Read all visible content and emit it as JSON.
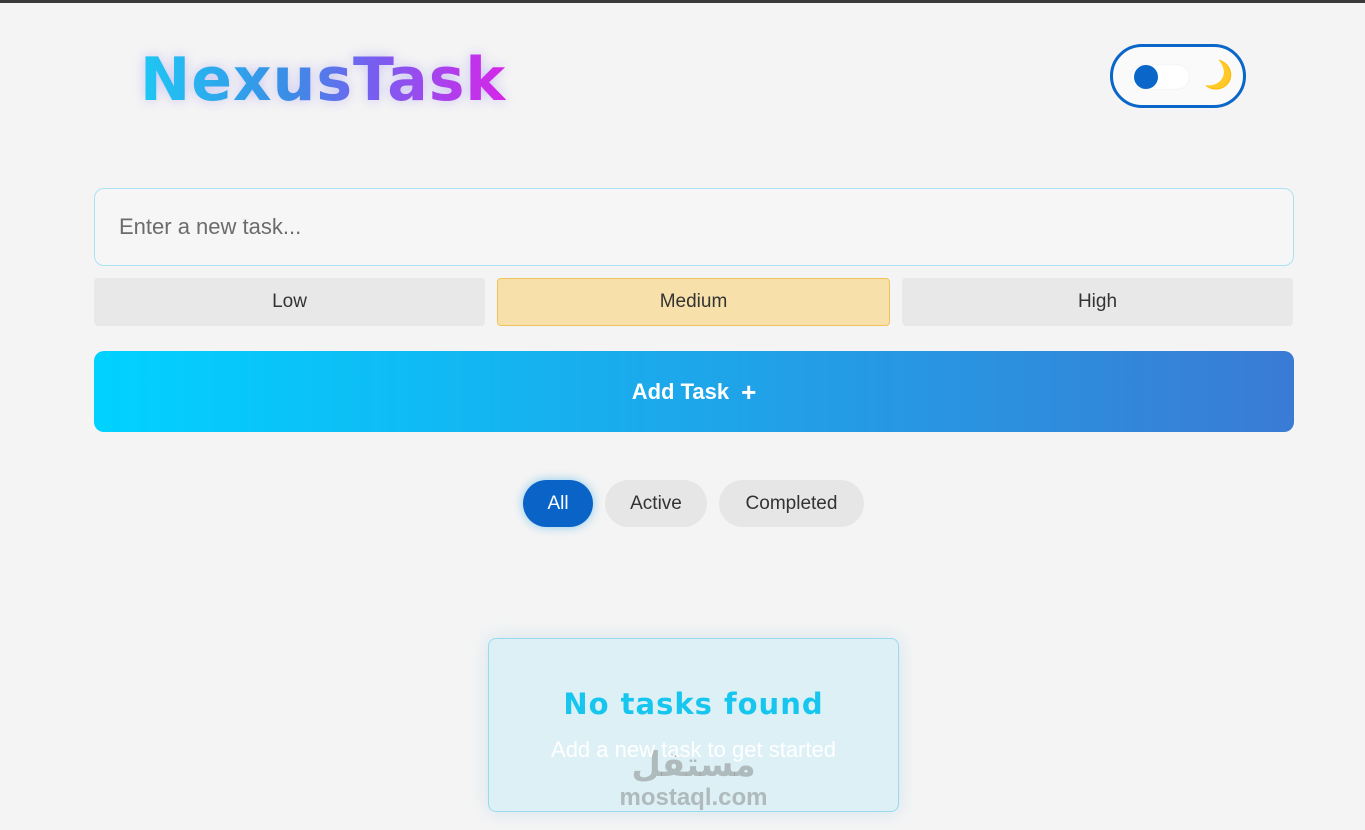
{
  "app": {
    "logo_text": "NexusTask"
  },
  "theme_toggle": {
    "state": "light",
    "moon_icon": "🌙"
  },
  "task_input": {
    "value": "",
    "placeholder": "Enter a new task..."
  },
  "priority": {
    "options": [
      "Low",
      "Medium",
      "High"
    ],
    "selected": "Medium"
  },
  "add_button": {
    "label": "Add Task",
    "icon": "+"
  },
  "filters": {
    "items": [
      "All",
      "Active",
      "Completed"
    ],
    "selected": "All"
  },
  "empty_state": {
    "title": "No tasks found",
    "subtitle": "Add a new task to get started"
  },
  "watermark": {
    "arabic": "مستقل",
    "latin": "mostaql.com"
  },
  "colors": {
    "accent": "#0a64c8",
    "gradient_start": "#00d2ff",
    "gradient_end": "#3a7bd5",
    "medium_priority_bg": "#f8e0ab",
    "empty_title": "#17c6ef"
  }
}
